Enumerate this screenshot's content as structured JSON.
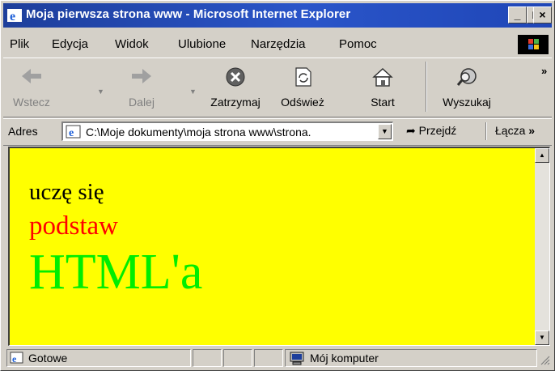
{
  "window": {
    "title": "Moja pierwsza strona www - Microsoft Internet Explorer",
    "controls": {
      "minimize": "_",
      "maximize": "□",
      "close": "×"
    }
  },
  "menu": {
    "items": [
      {
        "label": "Plik"
      },
      {
        "label": "Edycja"
      },
      {
        "label": "Widok"
      },
      {
        "label": "Ulubione"
      },
      {
        "label": "Narzędzia"
      },
      {
        "label": "Pomoc"
      }
    ]
  },
  "toolbar": {
    "back": {
      "label": "Wstecz",
      "icon": "back-arrow-icon"
    },
    "forward": {
      "label": "Dalej",
      "icon": "forward-arrow-icon"
    },
    "stop": {
      "label": "Zatrzymaj",
      "icon": "stop-icon"
    },
    "refresh": {
      "label": "Odśwież",
      "icon": "refresh-icon"
    },
    "home": {
      "label": "Start",
      "icon": "home-icon"
    },
    "search": {
      "label": "Wyszukaj",
      "icon": "search-icon"
    },
    "more": "»"
  },
  "address": {
    "label": "Adres",
    "url": "C:\\Moje dokumenty\\moja strona www\\strona.",
    "go": "Przejdź",
    "links": "Łącza",
    "links_more": "»"
  },
  "page": {
    "line1": "uczę się",
    "line2": "podstaw",
    "line3": "HTML'a",
    "background": "#ffff00",
    "line2_color": "#ff0000",
    "line3_color": "#00ee00"
  },
  "status": {
    "text": "Gotowe",
    "zone": "Mój komputer"
  }
}
